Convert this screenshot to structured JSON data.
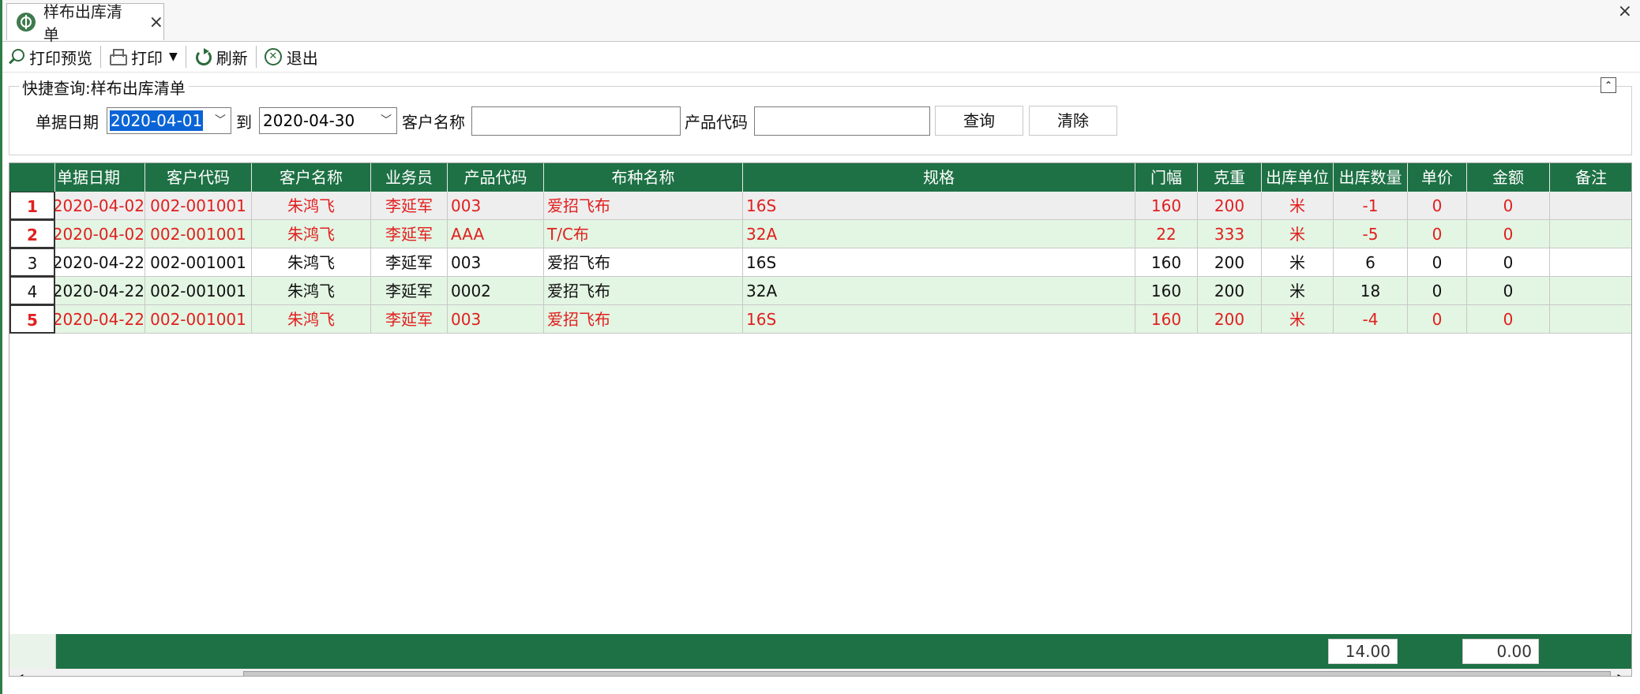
{
  "tab": {
    "title": "样布出库清单",
    "close": "×"
  },
  "window": {
    "close": "×"
  },
  "toolbar": {
    "print_preview": "打印预览",
    "print": "打印",
    "refresh": "刷新",
    "exit": "退出"
  },
  "query": {
    "title": "快捷查询:样布出库清单",
    "collapse": "⌃",
    "date_label": "单据日期",
    "date_from": "2020-04-01",
    "to_label": "到",
    "date_to": "2020-04-30",
    "customer_label": "客户名称",
    "customer_value": "",
    "product_label": "产品代码",
    "product_value": "",
    "search_btn": "查询",
    "clear_btn": "清除"
  },
  "grid": {
    "columns": [
      "单据日期",
      "客户代码",
      "客户名称",
      "业务员",
      "产品代码",
      "布种名称",
      "规格",
      "门幅",
      "克重",
      "出库单位",
      "出库数量",
      "单价",
      "金额",
      "备注"
    ],
    "rows": [
      {
        "no": "1",
        "date": "2020-04-02",
        "cust_code": "002-001001",
        "cust_name": "朱鸿飞",
        "sales": "李延军",
        "prod_code": "003",
        "fabric": "爱招飞布",
        "spec": "16S",
        "width": "160",
        "weight": "200",
        "unit": "米",
        "qty": "-1",
        "price": "0",
        "amount": "0",
        "note": "",
        "color": "red"
      },
      {
        "no": "2",
        "date": "2020-04-02",
        "cust_code": "002-001001",
        "cust_name": "朱鸿飞",
        "sales": "李延军",
        "prod_code": "AAA",
        "fabric": "T/C布",
        "spec": "32A",
        "width": "22",
        "weight": "333",
        "unit": "米",
        "qty": "-5",
        "price": "0",
        "amount": "0",
        "note": "",
        "color": "red"
      },
      {
        "no": "3",
        "date": "2020-04-22",
        "cust_code": "002-001001",
        "cust_name": "朱鸿飞",
        "sales": "李延军",
        "prod_code": "003",
        "fabric": "爱招飞布",
        "spec": "16S",
        "width": "160",
        "weight": "200",
        "unit": "米",
        "qty": "6",
        "price": "0",
        "amount": "0",
        "note": "",
        "color": "black"
      },
      {
        "no": "4",
        "date": "2020-04-22",
        "cust_code": "002-001001",
        "cust_name": "朱鸿飞",
        "sales": "李延军",
        "prod_code": "0002",
        "fabric": "爱招飞布",
        "spec": "32A",
        "width": "160",
        "weight": "200",
        "unit": "米",
        "qty": "18",
        "price": "0",
        "amount": "0",
        "note": "",
        "color": "black"
      },
      {
        "no": "5",
        "date": "2020-04-22",
        "cust_code": "002-001001",
        "cust_name": "朱鸿飞",
        "sales": "李延军",
        "prod_code": "003",
        "fabric": "爱招飞布",
        "spec": "16S",
        "width": "160",
        "weight": "200",
        "unit": "米",
        "qty": "-4",
        "price": "0",
        "amount": "0",
        "note": "",
        "color": "red"
      }
    ],
    "totals": {
      "qty": "14.00",
      "amount": "0.00"
    }
  },
  "scrollbar": {
    "left": "◀",
    "right": "▶"
  }
}
